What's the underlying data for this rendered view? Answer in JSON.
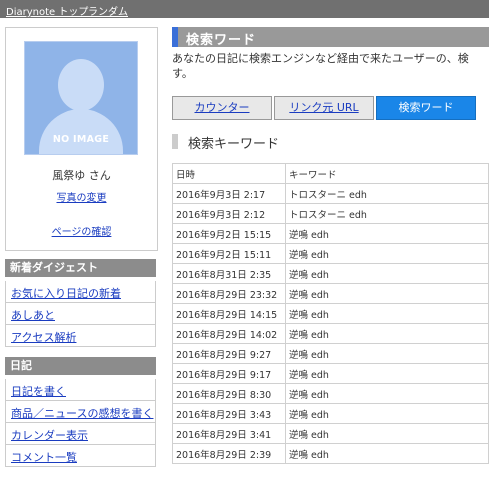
{
  "topnav": {
    "items": [
      "Diarynote トップ",
      "ランダム"
    ]
  },
  "profile": {
    "avatar_text": "NO IMAGE",
    "name": "風祭ゆ さん",
    "photo_change": "写真の変更",
    "page_check": "ページの確認"
  },
  "sidebar": {
    "digest_header": "新着ダイジェスト",
    "digest_items": [
      "お気に入り日記の新着",
      "あしあと",
      "アクセス解析"
    ],
    "diary_header": "日記",
    "diary_items": [
      "日記を書く",
      "商品／ニュースの感想を書く",
      "カレンダー表示",
      "コメント一覧"
    ]
  },
  "main": {
    "title": "検索ワード",
    "description_line1": "あなたの日記に検索エンジンなど経由で来たユーザーの、検",
    "description_line2": "す。",
    "tabs": [
      "カウンター",
      "リンク元 URL",
      "検索ワード"
    ],
    "active_tab": "検索ワード",
    "section_title": "検索キーワード",
    "table": {
      "headers": [
        "日時",
        "キーワード"
      ],
      "rows": [
        [
          "2016年9月3日 2:17",
          "トロスターニ edh"
        ],
        [
          "2016年9月3日 2:12",
          "トロスターニ edh"
        ],
        [
          "2016年9月2日 15:15",
          "逆鳴 edh"
        ],
        [
          "2016年9月2日 15:11",
          "逆鳴 edh"
        ],
        [
          "2016年8月31日 2:35",
          "逆鳴 edh"
        ],
        [
          "2016年8月29日 23:32",
          "逆鳴 edh"
        ],
        [
          "2016年8月29日 14:15",
          "逆鳴 edh"
        ],
        [
          "2016年8月29日 14:02",
          "逆鳴 edh"
        ],
        [
          "2016年8月29日 9:27",
          "逆鳴 edh"
        ],
        [
          "2016年8月29日 9:17",
          "逆鳴 edh"
        ],
        [
          "2016年8月29日 8:30",
          "逆鳴 edh"
        ],
        [
          "2016年8月29日 3:43",
          "逆鳴 edh"
        ],
        [
          "2016年8月29日 3:41",
          "逆鳴 edh"
        ],
        [
          "2016年8月29日 2:39",
          "逆鳴 edh"
        ]
      ]
    }
  },
  "colors": {
    "link": "#1a3cc0",
    "active_tab": "#1a86e8",
    "title_accent": "#3a6fd8",
    "title_bg": "#999999",
    "topbar": "#707070"
  }
}
